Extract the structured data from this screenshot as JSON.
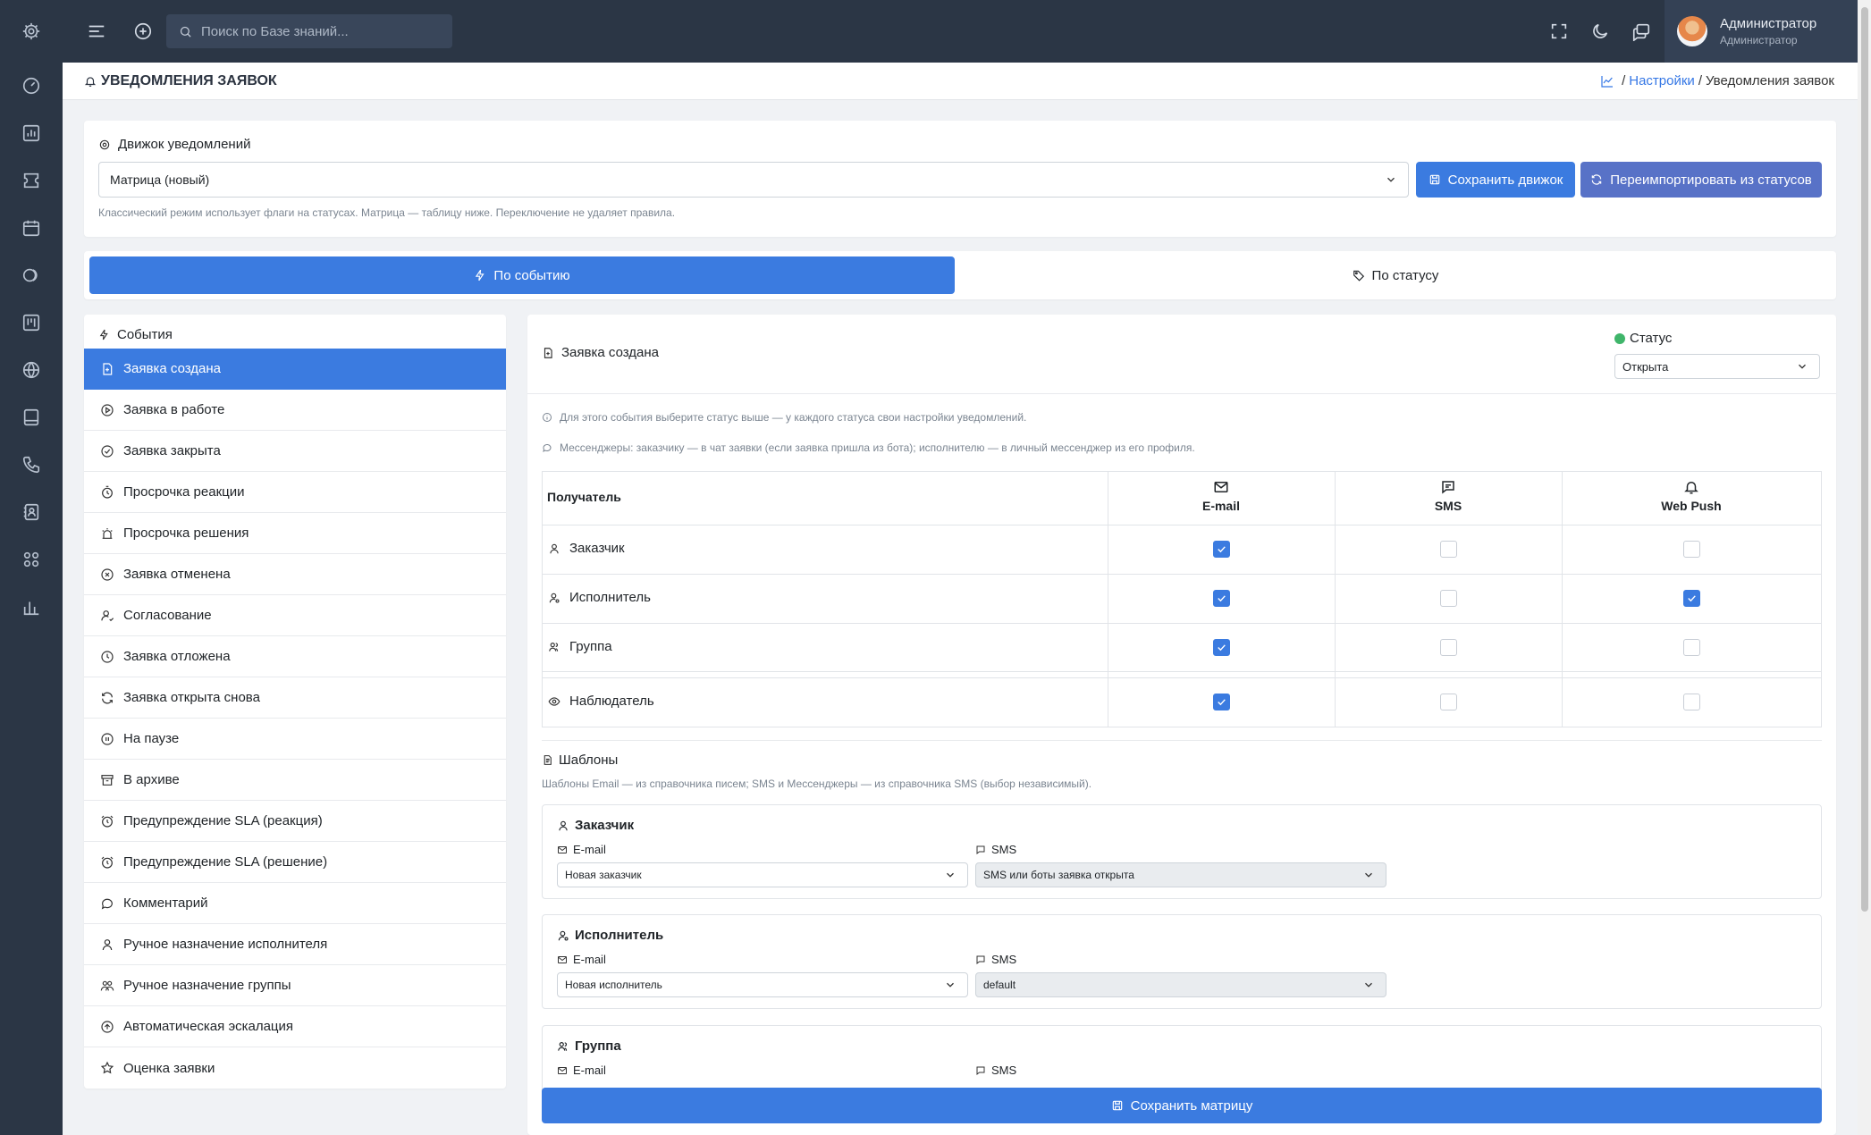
{
  "topbar": {
    "search_placeholder": "Поиск по Базе знаний...",
    "user_name": "Администратор",
    "user_role": "Администратор"
  },
  "page": {
    "title": "УВЕДОМЛЕНИЯ ЗАЯВОК",
    "breadcrumb_settings": "Настройки",
    "breadcrumb_sep1": "/",
    "breadcrumb_sep2": "/",
    "breadcrumb_current": "Уведомления заявок"
  },
  "engine": {
    "label": "Движок уведомлений",
    "selected": "Матрица (новый)",
    "save_label": "Сохранить движок",
    "reimport_label": "Переимпортировать из статусов",
    "help": "Классический режим использует флаги на статусах. Матрица — таблицу ниже. Переключение не удаляет правила."
  },
  "mode": {
    "by_event": "По событию",
    "by_status": "По статусу"
  },
  "events": {
    "header": "События",
    "items": [
      {
        "label": "Заявка создана",
        "icon": "file-plus-icon",
        "active": true
      },
      {
        "label": "Заявка в работе",
        "icon": "play-circle-icon",
        "active": false
      },
      {
        "label": "Заявка закрыта",
        "icon": "check-circle-icon",
        "active": false
      },
      {
        "label": "Просрочка реакции",
        "icon": "stopwatch-icon",
        "active": false
      },
      {
        "label": "Просрочка решения",
        "icon": "alarm-siren-icon",
        "active": false
      },
      {
        "label": "Заявка отменена",
        "icon": "x-circle-icon",
        "active": false
      },
      {
        "label": "Согласование",
        "icon": "user-check-icon",
        "active": false
      },
      {
        "label": "Заявка отложена",
        "icon": "clock-icon",
        "active": false
      },
      {
        "label": "Заявка открыта снова",
        "icon": "refresh-icon",
        "active": false
      },
      {
        "label": "На паузе",
        "icon": "pause-circle-icon",
        "active": false
      },
      {
        "label": "В архиве",
        "icon": "archive-icon",
        "active": false
      },
      {
        "label": "Предупреждение SLA (реакция)",
        "icon": "alarm-clock-icon",
        "active": false
      },
      {
        "label": "Предупреждение SLA (решение)",
        "icon": "alarm-clock-icon",
        "active": false
      },
      {
        "label": "Комментарий",
        "icon": "chat-icon",
        "active": false
      },
      {
        "label": "Ручное назначение исполнителя",
        "icon": "user-icon",
        "active": false
      },
      {
        "label": "Ручное назначение группы",
        "icon": "users-icon",
        "active": false
      },
      {
        "label": "Автоматическая эскалация",
        "icon": "arrow-up-circle-icon",
        "active": false
      },
      {
        "label": "Оценка заявки",
        "icon": "star-icon",
        "active": false
      }
    ]
  },
  "matrix": {
    "event_title": "Заявка создана",
    "status_label": "Статус",
    "status_value": "Открыта",
    "note1": "Для этого события выберите статус выше — у каждого статуса свои настройки уведомлений.",
    "note2": "Мессенджеры: заказчику — в чат заявки (если заявка пришла из бота); исполнителю — в личный мессенджер из его профиля.",
    "recipient_header": "Получатель",
    "channels": [
      "E-mail",
      "SMS",
      "Web Push"
    ],
    "rows": [
      {
        "label": "Заказчик",
        "icon": "user-icon",
        "email": true,
        "sms": false,
        "push": false
      },
      {
        "label": "Исполнитель",
        "icon": "user-gear-icon",
        "email": true,
        "sms": false,
        "push": true
      },
      {
        "label": "Группа",
        "icon": "users-icon",
        "email": true,
        "sms": false,
        "push": false
      },
      {
        "label": "Наблюдатель",
        "icon": "eye-icon",
        "email": true,
        "sms": false,
        "push": false
      }
    ]
  },
  "templates": {
    "title": "Шаблоны",
    "help": "Шаблоны Email — из справочника писем; SMS и Мессенджеры — из справочника SMS (выбор независимый).",
    "email_label": "E-mail",
    "sms_label": "SMS",
    "cards": [
      {
        "title": "Заказчик",
        "email": "Новая заказчик",
        "sms": "SMS или боты заявка открыта"
      },
      {
        "title": "Исполнитель",
        "email": "Новая исполнитель",
        "sms": "default"
      },
      {
        "title": "Группа",
        "email": "",
        "sms": ""
      }
    ]
  },
  "save_matrix_label": "Сохранить матрицу"
}
